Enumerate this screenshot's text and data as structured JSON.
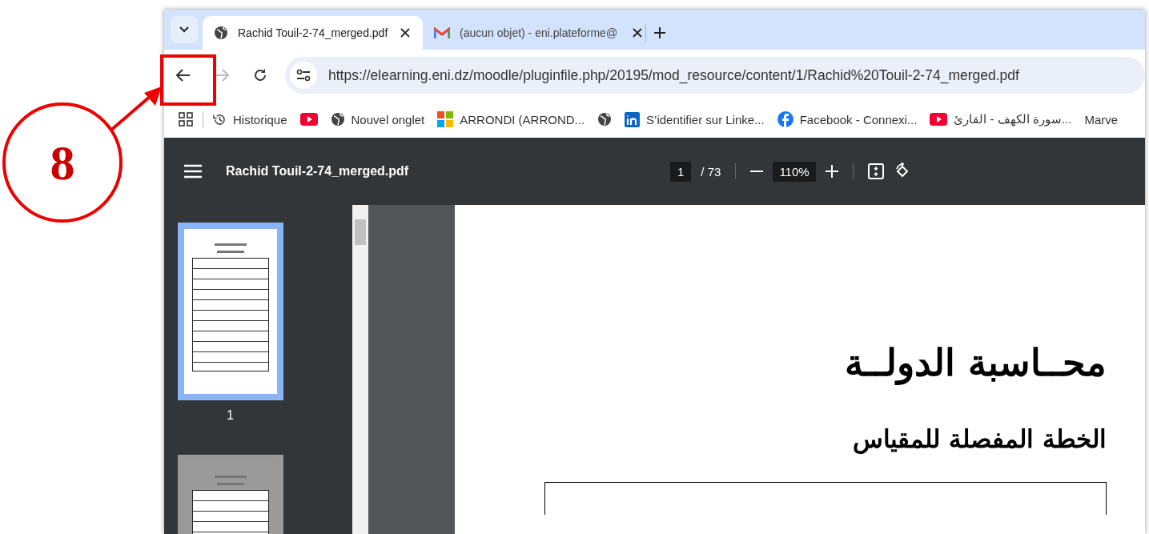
{
  "annotation": {
    "number": "8"
  },
  "tabs": [
    {
      "title": "Rachid Touil-2-74_merged.pdf",
      "kind": "globe",
      "selected": true
    },
    {
      "title": "(aucun objet) - eni.plateforme@",
      "kind": "mail",
      "selected": false
    }
  ],
  "address_bar": {
    "url": "https://elearning.eni.dz/moodle/pluginfile.php/20195/mod_resource/content/1/Rachid%20Touil-2-74_merged.pdf"
  },
  "bookmarks": [
    {
      "kind": "history",
      "label": "Historique"
    },
    {
      "kind": "video"
    },
    {
      "kind": "globe",
      "label": "Nouvel onglet"
    },
    {
      "kind": "windows",
      "label": "ARRONDI (ARROND..."
    },
    {
      "kind": "globe"
    },
    {
      "kind": "linkedin",
      "label": "S’identifier sur Linke..."
    },
    {
      "kind": "facebook",
      "label": "Facebook - Connexi..."
    },
    {
      "kind": "video",
      "label": "سورة الكهف - القارئ..."
    },
    {
      "label": "Marve"
    }
  ],
  "pdf_viewer": {
    "title": "Rachid Touil-2-74_merged.pdf",
    "page": "1",
    "page_count": "/ 73",
    "zoom": "110%",
    "thumbnails": [
      {
        "label": "1",
        "selected": true
      },
      {
        "selected": false
      }
    ],
    "heading": "محــاسبة الدولــة",
    "subheading": "الخطة المفصلة للمقياس"
  }
}
